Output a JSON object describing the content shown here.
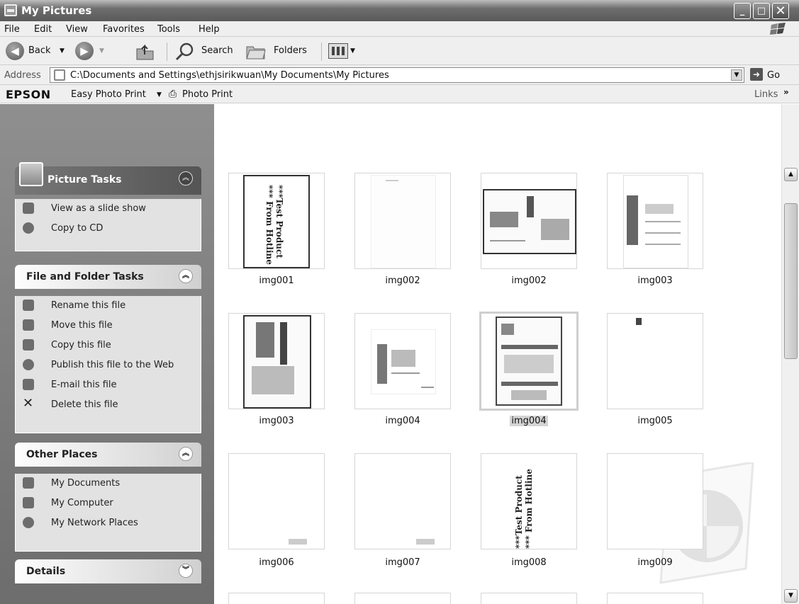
{
  "window": {
    "title": "My Pictures",
    "min": "_",
    "max": "□",
    "close": "✕"
  },
  "menu": [
    "File",
    "Edit",
    "View",
    "Favorites",
    "Tools",
    "Help"
  ],
  "toolbar": {
    "back": "Back",
    "search": "Search",
    "folders": "Folders"
  },
  "address": {
    "label": "Address",
    "value": "C:\\Documents and Settings\\ethjsirikwuan\\My Documents\\My Pictures",
    "go": "Go"
  },
  "epson": {
    "brand": "EPSON",
    "easy_photo_print": "Easy Photo Print",
    "photo_print": "Photo Print",
    "links": "Links"
  },
  "picture_tasks": {
    "title": "Picture Tasks",
    "items": [
      "View as a slide show",
      "Copy to CD"
    ]
  },
  "file_tasks": {
    "title": "File and Folder Tasks",
    "items": [
      "Rename this file",
      "Move this file",
      "Copy this file",
      "Publish this file to the Web",
      "E-mail this file",
      "Delete this file"
    ]
  },
  "other_places": {
    "title": "Other Places",
    "items": [
      "My Documents",
      "My Computer",
      "My Network Places"
    ]
  },
  "details": {
    "title": "Details"
  },
  "thumbs": [
    {
      "name": "img001",
      "selected": false,
      "vtext": "***Test Product ***\nFrom Hotline"
    },
    {
      "name": "img002",
      "selected": false
    },
    {
      "name": "img002",
      "selected": false
    },
    {
      "name": "img003",
      "selected": false
    },
    {
      "name": "img003",
      "selected": false
    },
    {
      "name": "img004",
      "selected": false
    },
    {
      "name": "img004",
      "selected": true
    },
    {
      "name": "img005",
      "selected": false
    },
    {
      "name": "img006",
      "selected": false
    },
    {
      "name": "img007",
      "selected": false
    },
    {
      "name": "img008",
      "selected": false,
      "vtext": "***Test Product ***\nFrom Hotline"
    },
    {
      "name": "img009",
      "selected": false
    }
  ]
}
